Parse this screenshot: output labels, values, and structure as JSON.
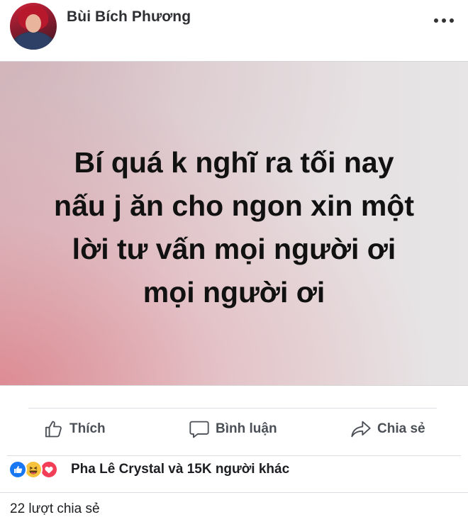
{
  "header": {
    "author_name": "Bùi Bích Phương",
    "more_icon": "more-horizontal-icon"
  },
  "card": {
    "text": "Bí quá k nghĩ ra tối nay\nnấu j ăn cho ngon xin một\nlời tư vấn mọi người ơi\nmọi người ơi"
  },
  "actions": {
    "like_label": "Thích",
    "comment_label": "Bình luận",
    "share_label": "Chia sẻ",
    "like_icon": "thumbs-up-icon",
    "comment_icon": "speech-bubble-icon",
    "share_icon": "share-arrow-icon"
  },
  "reactions": {
    "icons": [
      "like-reaction-icon",
      "haha-reaction-icon",
      "love-reaction-icon"
    ],
    "summary": "Pha Lê Crystal và 15K người khác"
  },
  "shares": {
    "summary": "22 lượt chia sẻ"
  },
  "colors": {
    "like_blue": "#1877f2",
    "haha_yellow": "#f7c33d",
    "love_red": "#f33e58",
    "action_gray": "#4b4f56"
  }
}
